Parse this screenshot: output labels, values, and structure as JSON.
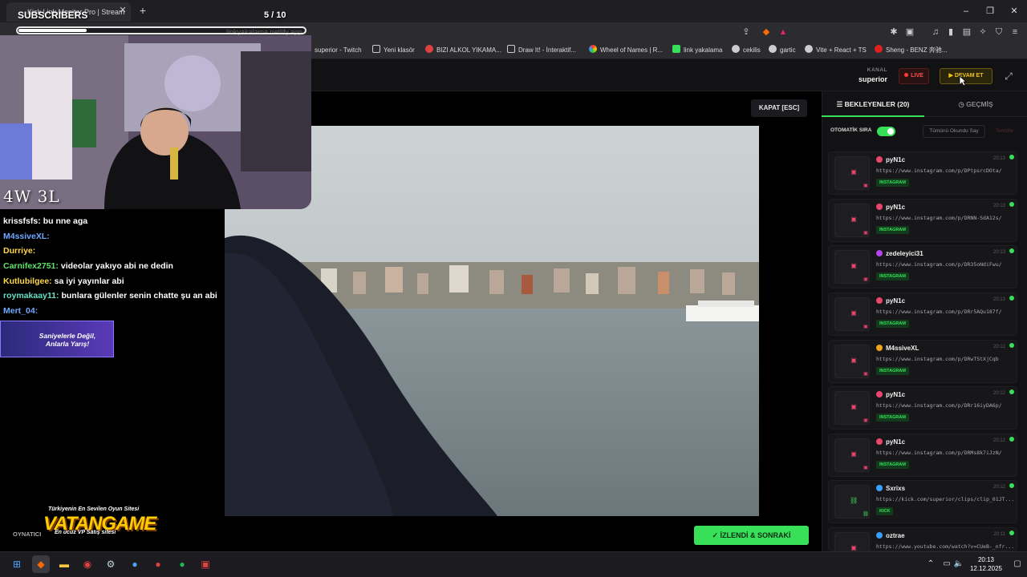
{
  "browser": {
    "tab_title": "Kick Link Monitor Pro | Stream",
    "url": "linkyakalama.netlify.app",
    "bookmarks": [
      "superior - Twitch",
      "Yeni klasör",
      "BIZI ALKOL YIKAMA...",
      "Draw It! - İnteraktif...",
      "Wheel of Names | R...",
      "link yakalama",
      "cekilis",
      "gartic",
      "Vite + React + TS",
      "Sheng - BENZ 奔驰..."
    ]
  },
  "header": {
    "kanal_label": "KANAL",
    "kanal_name": "superior",
    "live_label": "LIVE",
    "devam_label": "DEVAM ET"
  },
  "stage": {
    "kapat_label": "KAPAT [ESC]",
    "izlendi_label": "İZLENDİ & SONRAKİ"
  },
  "panel": {
    "tab_bekleyenler": "BEKLEYENLER (20)",
    "tab_gecmis": "GEÇMİŞ",
    "otomatik_sira": "OTOMATİK SIRA",
    "tumunu_okundu": "Tümünü Okundu Say",
    "temizle": "Temizle",
    "queue": [
      {
        "user": "pyN1c",
        "time": "20:13",
        "url": "https://www.instagram.com/p/DPtpsrcDOta/",
        "platform": "INSTAGRAM",
        "badge_color": "#e8466e"
      },
      {
        "user": "pyN1c",
        "time": "20:13",
        "url": "https://www.instagram.com/p/DRNN-SdA12s/",
        "platform": "INSTAGRAM",
        "badge_color": "#e8466e"
      },
      {
        "user": "zedeleyici31",
        "time": "20:13",
        "url": "https://www.instagram.com/p/DR35oNdiFwu/",
        "platform": "INSTAGRAM",
        "badge_color": "#b245e8"
      },
      {
        "user": "pyN1c",
        "time": "20:13",
        "url": "https://www.instagram.com/p/DRr5AQu187f/",
        "platform": "INSTAGRAM",
        "badge_color": "#e8466e"
      },
      {
        "user": "M4ssiveXL",
        "time": "20:12",
        "url": "https://www.instagram.com/p/DRwTStXjCqb",
        "platform": "INSTAGRAM",
        "badge_color": "#f0a419"
      },
      {
        "user": "pyN1c",
        "time": "20:12",
        "url": "https://www.instagram.com/p/DRr16iyDA6p/",
        "platform": "INSTAGRAM",
        "badge_color": "#e8466e"
      },
      {
        "user": "pyN1c",
        "time": "20:12",
        "url": "https://www.instagram.com/p/DRMs8k7iJzN/",
        "platform": "INSTAGRAM",
        "badge_color": "#e8466e"
      },
      {
        "user": "Sxrixs",
        "time": "20:12",
        "url": "https://kick.com/superior/clips/clip_01JT...",
        "platform": "KICK",
        "badge_color": "#3aa0ff"
      },
      {
        "user": "oztrae",
        "time": "20:11",
        "url": "https://www.youtube.com/watch?v=CUeB-_nfr...",
        "platform": "",
        "badge_color": "#3aa0ff"
      }
    ]
  },
  "overlay": {
    "subscribers_label": "SUBSCRIBERS",
    "sub_count": "5  / 10",
    "sub_progress": 0.5,
    "score": "4W 3L",
    "chat": [
      {
        "user": "krissfsfs:",
        "msg": "bu nne aga",
        "color": "#ffffff"
      },
      {
        "user": "M4ssiveXL:",
        "msg": "",
        "color": "#6fa8ff"
      },
      {
        "user": "Durriye:",
        "msg": "",
        "color": "#ffd84a"
      },
      {
        "user": "Carnifex2751:",
        "msg": "videolar yakıyo abi ne dedin",
        "color": "#63e26b"
      },
      {
        "user": "Kutlubilgee:",
        "msg": "sa iyi yayınlar abi",
        "color": "#ffd84a"
      },
      {
        "user": "roymakaay11:",
        "msg": "bunlara gülenler senin chatte şu an abi",
        "color": "#63e2c8"
      },
      {
        "user": "Mert_04:",
        "msg": "",
        "color": "#6fa8ff"
      }
    ],
    "promo": "Saniyelerle Değil, Anlarla Yarış!",
    "vatan_tag": "Türkiyenin En Sevilen Oyun Sitesi",
    "vatan_logo": "VATANGAME",
    "vatan_sub": "En ucuz VP Satış sitesi",
    "oynatici": "OYNATICI"
  },
  "taskbar": {
    "time": "20:13",
    "date": "12.12.2025"
  }
}
